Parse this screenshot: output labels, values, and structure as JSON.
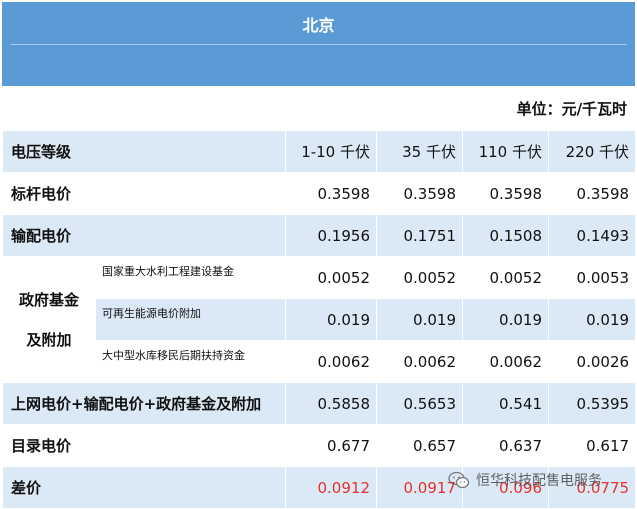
{
  "title": "北京",
  "unit": "单位：元/千瓦时",
  "header": {
    "label": "电压等级",
    "cols": [
      "1-10 千伏",
      "35 千伏",
      "110 千伏",
      "220 千伏"
    ]
  },
  "rows": {
    "benchmark": {
      "label": "标杆电价",
      "values": [
        "0.3598",
        "0.3598",
        "0.3598",
        "0.3598"
      ]
    },
    "transmission": {
      "label": "输配电价",
      "values": [
        "0.1956",
        "0.1751",
        "0.1508",
        "0.1493"
      ]
    },
    "gov": {
      "label_line1": "政府基金",
      "label_line2": "及附加",
      "items": [
        {
          "label": "国家重大水利工程建设基金",
          "values": [
            "0.0052",
            "0.0052",
            "0.0052",
            "0.0053"
          ]
        },
        {
          "label": "可再生能源电价附加",
          "values": [
            "0.019",
            "0.019",
            "0.019",
            "0.019"
          ]
        },
        {
          "label": "大中型水库移民后期扶持资金",
          "values": [
            "0.0062",
            "0.0062",
            "0.0062",
            "0.0026"
          ]
        }
      ]
    },
    "total": {
      "label": "上网电价+输配电价+政府基金及附加",
      "values": [
        "0.5858",
        "0.5653",
        "0.541",
        "0.5395"
      ]
    },
    "catalog": {
      "label": "目录电价",
      "values": [
        "0.677",
        "0.657",
        "0.637",
        "0.617"
      ]
    },
    "diff": {
      "label": "差价",
      "values": [
        "0.0912",
        "0.0917",
        "0.096",
        "0.0775"
      ],
      "color": "#e8312a"
    }
  },
  "watermark": {
    "text": "恒华科技配售电服务",
    "icon": "wechat-icon"
  },
  "colors": {
    "header_band": "#5b9bd5",
    "row_shade": "#dbe8f5"
  }
}
